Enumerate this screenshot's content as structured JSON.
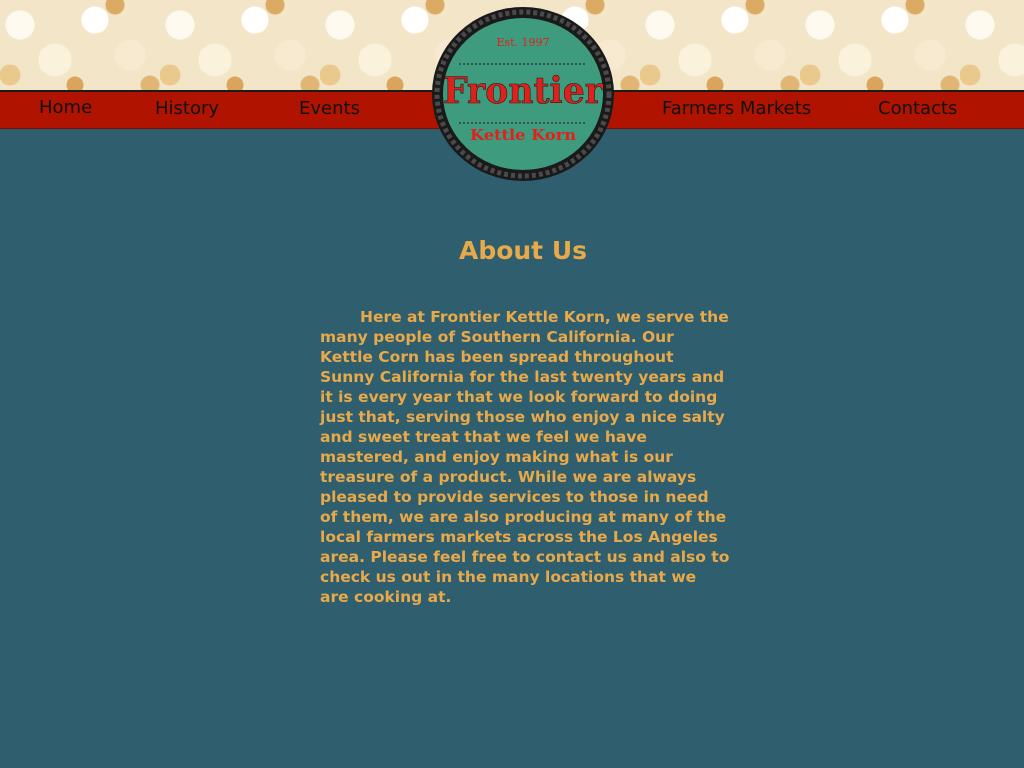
{
  "nav": {
    "home": "Home",
    "history": "History",
    "events": "Events",
    "farmers_markets": "Farmers Markets",
    "contacts": "Contacts"
  },
  "logo": {
    "established": "Est. 1997",
    "name": "Frontier",
    "subtitle": "Kettle Korn"
  },
  "about": {
    "heading": "About Us",
    "body": "Here at Frontier Kettle Korn, we serve the many people of Southern California. Our Kettle Corn has been spread throughout Sunny California for the last twenty years and it is every year that we look forward to doing just that, serving those who enjoy a nice salty and sweet treat that we feel we have mastered, and enjoy making what is our treasure of a product. While we are always pleased to provide services to those in need of them, we are also producing at many of the local farmers markets across the Los Angeles area. Please feel free to contact us and also to check us out in the many locations that we are cooking at."
  },
  "colors": {
    "background": "#2f5e6e",
    "nav_bar": "#b01400",
    "text_accent": "#e8a94a",
    "logo_fill": "#3f9b7e",
    "logo_red": "#e0201b"
  }
}
